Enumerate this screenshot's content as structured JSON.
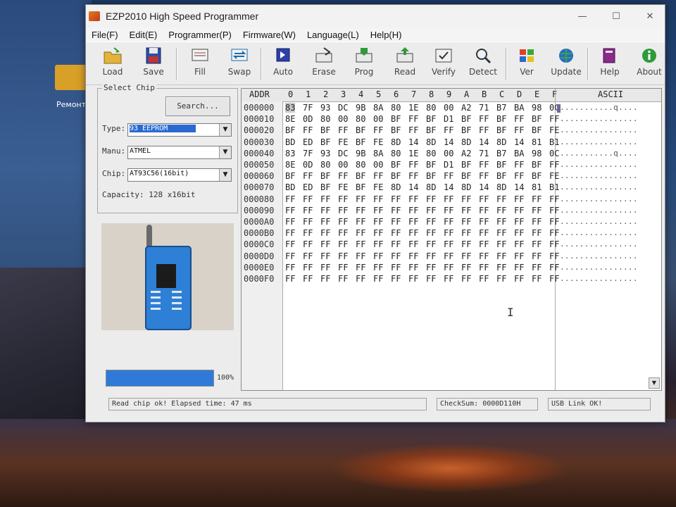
{
  "desktop": {
    "folder_label": "Ремонт"
  },
  "window": {
    "title": "EZP2010 High Speed Programmer",
    "controls": [
      "—",
      "☐",
      "✕"
    ]
  },
  "menu": [
    "File(F)",
    "Edit(E)",
    "Programmer(P)",
    "Firmware(W)",
    "Language(L)",
    "Help(H)"
  ],
  "toolbar": {
    "load": "Load",
    "save": "Save",
    "fill": "Fill",
    "swap": "Swap",
    "auto": "Auto",
    "erase": "Erase",
    "prog": "Prog",
    "read": "Read",
    "verify": "Verify",
    "detect": "Detect",
    "ver": "Ver",
    "update": "Update",
    "help": "Help",
    "about": "About"
  },
  "select_chip": {
    "group_title": "Select Chip",
    "search_label": "Search...",
    "type_label": "Type:",
    "type_value": "93 EEPROM",
    "manu_label": "Manu:",
    "manu_value": "ATMEL",
    "chip_label": "Chip:",
    "chip_value": "AT93C56(16bit)",
    "capacity": "Capacity: 128 x16bit"
  },
  "progress": {
    "value": 100,
    "text": "100%"
  },
  "hex": {
    "addr_header": "ADDR",
    "columns": [
      "0",
      "1",
      "2",
      "3",
      "4",
      "5",
      "6",
      "7",
      "8",
      "9",
      "A",
      "B",
      "C",
      "D",
      "E",
      "F"
    ],
    "ascii_header": "ASCII",
    "rows": [
      {
        "addr": "000000",
        "bytes": [
          "83",
          "7F",
          "93",
          "DC",
          "9B",
          "8A",
          "80",
          "1E",
          "80",
          "00",
          "A2",
          "71",
          "B7",
          "BA",
          "98",
          "0C"
        ],
        "ascii": "...........q...."
      },
      {
        "addr": "000010",
        "bytes": [
          "8E",
          "0D",
          "80",
          "00",
          "80",
          "00",
          "BF",
          "FF",
          "BF",
          "D1",
          "BF",
          "FF",
          "BF",
          "FF",
          "BF",
          "FF"
        ],
        "ascii": "................"
      },
      {
        "addr": "000020",
        "bytes": [
          "BF",
          "FF",
          "BF",
          "FF",
          "BF",
          "FF",
          "BF",
          "FF",
          "BF",
          "FF",
          "BF",
          "FF",
          "BF",
          "FF",
          "BF",
          "FE"
        ],
        "ascii": "................"
      },
      {
        "addr": "000030",
        "bytes": [
          "BD",
          "ED",
          "BF",
          "FE",
          "BF",
          "FE",
          "8D",
          "14",
          "8D",
          "14",
          "8D",
          "14",
          "8D",
          "14",
          "81",
          "B1"
        ],
        "ascii": "................"
      },
      {
        "addr": "000040",
        "bytes": [
          "83",
          "7F",
          "93",
          "DC",
          "9B",
          "8A",
          "80",
          "1E",
          "80",
          "00",
          "A2",
          "71",
          "B7",
          "BA",
          "98",
          "0C"
        ],
        "ascii": "...........q...."
      },
      {
        "addr": "000050",
        "bytes": [
          "8E",
          "0D",
          "80",
          "00",
          "80",
          "00",
          "BF",
          "FF",
          "BF",
          "D1",
          "BF",
          "FF",
          "BF",
          "FF",
          "BF",
          "FF"
        ],
        "ascii": "................"
      },
      {
        "addr": "000060",
        "bytes": [
          "BF",
          "FF",
          "BF",
          "FF",
          "BF",
          "FF",
          "BF",
          "FF",
          "BF",
          "FF",
          "BF",
          "FF",
          "BF",
          "FF",
          "BF",
          "FE"
        ],
        "ascii": "................"
      },
      {
        "addr": "000070",
        "bytes": [
          "BD",
          "ED",
          "BF",
          "FE",
          "BF",
          "FE",
          "8D",
          "14",
          "8D",
          "14",
          "8D",
          "14",
          "8D",
          "14",
          "81",
          "B1"
        ],
        "ascii": "................"
      },
      {
        "addr": "000080",
        "bytes": [
          "FF",
          "FF",
          "FF",
          "FF",
          "FF",
          "FF",
          "FF",
          "FF",
          "FF",
          "FF",
          "FF",
          "FF",
          "FF",
          "FF",
          "FF",
          "FF"
        ],
        "ascii": "................"
      },
      {
        "addr": "000090",
        "bytes": [
          "FF",
          "FF",
          "FF",
          "FF",
          "FF",
          "FF",
          "FF",
          "FF",
          "FF",
          "FF",
          "FF",
          "FF",
          "FF",
          "FF",
          "FF",
          "FF"
        ],
        "ascii": "................"
      },
      {
        "addr": "0000A0",
        "bytes": [
          "FF",
          "FF",
          "FF",
          "FF",
          "FF",
          "FF",
          "FF",
          "FF",
          "FF",
          "FF",
          "FF",
          "FF",
          "FF",
          "FF",
          "FF",
          "FF"
        ],
        "ascii": "................"
      },
      {
        "addr": "0000B0",
        "bytes": [
          "FF",
          "FF",
          "FF",
          "FF",
          "FF",
          "FF",
          "FF",
          "FF",
          "FF",
          "FF",
          "FF",
          "FF",
          "FF",
          "FF",
          "FF",
          "FF"
        ],
        "ascii": "................"
      },
      {
        "addr": "0000C0",
        "bytes": [
          "FF",
          "FF",
          "FF",
          "FF",
          "FF",
          "FF",
          "FF",
          "FF",
          "FF",
          "FF",
          "FF",
          "FF",
          "FF",
          "FF",
          "FF",
          "FF"
        ],
        "ascii": "................"
      },
      {
        "addr": "0000D0",
        "bytes": [
          "FF",
          "FF",
          "FF",
          "FF",
          "FF",
          "FF",
          "FF",
          "FF",
          "FF",
          "FF",
          "FF",
          "FF",
          "FF",
          "FF",
          "FF",
          "FF"
        ],
        "ascii": "................"
      },
      {
        "addr": "0000E0",
        "bytes": [
          "FF",
          "FF",
          "FF",
          "FF",
          "FF",
          "FF",
          "FF",
          "FF",
          "FF",
          "FF",
          "FF",
          "FF",
          "FF",
          "FF",
          "FF",
          "FF"
        ],
        "ascii": "................"
      },
      {
        "addr": "0000F0",
        "bytes": [
          "FF",
          "FF",
          "FF",
          "FF",
          "FF",
          "FF",
          "FF",
          "FF",
          "FF",
          "FF",
          "FF",
          "FF",
          "FF",
          "FF",
          "FF",
          "FF"
        ],
        "ascii": "................"
      }
    ]
  },
  "status": {
    "message": "Read chip ok!  Elapsed time: 47 ms",
    "checksum": "CheckSum: 0000D110H",
    "usb": "USB Link OK!"
  },
  "colors": {
    "accent": "#2f7ad8",
    "selection": "#2a6ad0"
  }
}
